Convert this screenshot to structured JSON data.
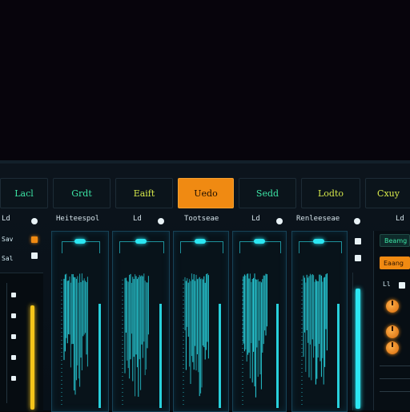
{
  "tabs": [
    {
      "label": "Lacl",
      "color": "#3de6a6",
      "active": false
    },
    {
      "label": "Grdt",
      "color": "#3de6a6",
      "active": false
    },
    {
      "label": "Eaift",
      "color": "#d6e84a",
      "active": false
    },
    {
      "label": "Uedo",
      "color": "#1a0c00",
      "active": true
    },
    {
      "label": "Sedd",
      "color": "#3de6a6",
      "active": false
    },
    {
      "label": "Lodto",
      "color": "#d6e84a",
      "active": false
    },
    {
      "label": "Cxuy",
      "color": "#d6e84a",
      "active": false
    }
  ],
  "headers": {
    "h1": "Ld",
    "h2": "Heiteespol",
    "h3": "Ld",
    "h4": "Tootseae",
    "h5": "Ld",
    "h6": "Renleeseae",
    "h7": "Ld"
  },
  "left_labels": {
    "a": "Sav",
    "b": "Sal"
  },
  "right_panel": {
    "btn1": "Beamg",
    "btn2": "Eaang",
    "label": "Ll"
  },
  "colors": {
    "accent": "#f08a12",
    "cyan": "#2ce6f2",
    "magenta": "#e020d0",
    "yellow": "#f5c51a"
  }
}
